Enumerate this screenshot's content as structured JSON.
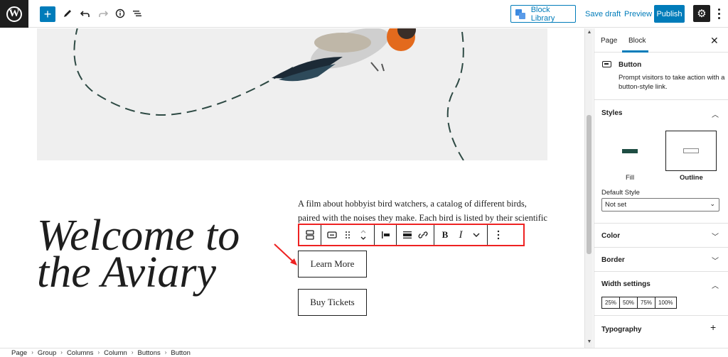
{
  "topbar": {
    "block_library_label": "Block Library",
    "save_draft_label": "Save draft",
    "preview_label": "Preview",
    "publish_label": "Publish"
  },
  "canvas": {
    "heading_line1": "Welcome to",
    "heading_line2": "the Aviary",
    "paragraph": "A film about hobbyist bird watchers, a catalog of different birds, paired with the noises they make. Each bird is listed by their scientific name so",
    "buttons": [
      "Learn More",
      "Buy Tickets"
    ]
  },
  "sidebar": {
    "tabs": [
      "Page",
      "Block"
    ],
    "active_tab": "Block",
    "block_name": "Button",
    "block_description": "Prompt visitors to take action with a button-style link.",
    "sections": {
      "styles": "Styles",
      "color": "Color",
      "border": "Border",
      "width_settings": "Width settings",
      "typography": "Typography"
    },
    "style_options": [
      "Fill",
      "Outline"
    ],
    "selected_style": "Outline",
    "default_style_label": "Default Style",
    "default_style_value": "Not set",
    "width_options": [
      "25%",
      "50%",
      "75%",
      "100%"
    ]
  },
  "breadcrumb": [
    "Page",
    "Group",
    "Columns",
    "Column",
    "Buttons",
    "Button"
  ],
  "colors": {
    "accent": "#007cba",
    "toolbar_highlight": "#e22222",
    "fill_style_preview": "#1e4d43",
    "dashed_line": "#2e4a44"
  }
}
